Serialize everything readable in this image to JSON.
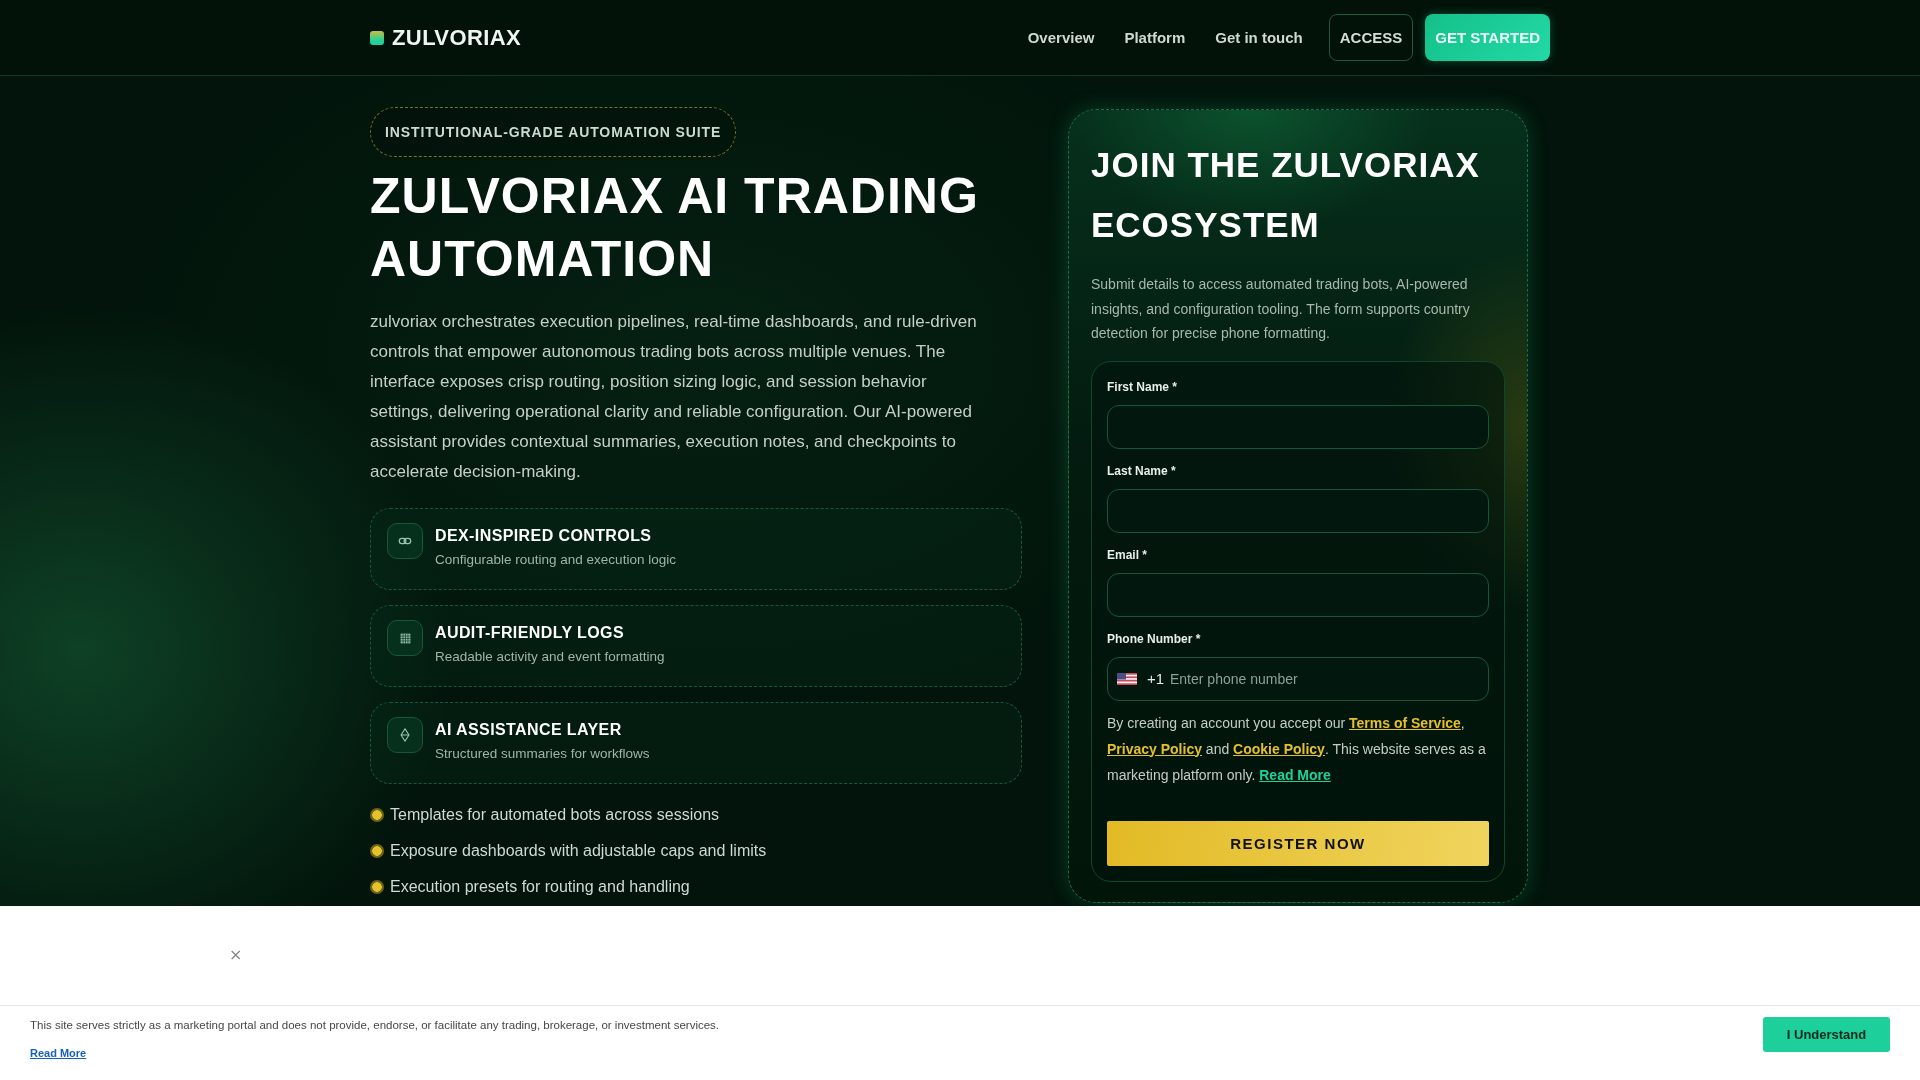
{
  "header": {
    "brand": "ZULVORIAX",
    "nav": [
      "Overview",
      "Platform",
      "Get in touch"
    ],
    "actions": [
      {
        "label": "ACCESS",
        "kind": "outline"
      },
      {
        "label": "GET STARTED",
        "kind": "primary"
      }
    ]
  },
  "hero": {
    "badge": "INSTITUTIONAL-GRADE AUTOMATION SUITE",
    "title": "ZULVORIAX AI TRADING AUTOMATION",
    "description": "zulvoriax orchestrates execution pipelines, real-time dashboards, and rule-driven controls that empower autonomous trading bots across multiple venues. The interface exposes crisp routing, position sizing logic, and session behavior settings, delivering operational clarity and reliable configuration. Our AI-powered assistant provides contextual summaries, execution notes, and checkpoints to accelerate decision-making.",
    "features": [
      {
        "title": "DEX-INSPIRED CONTROLS",
        "subtitle": "Configurable routing and execution logic"
      },
      {
        "title": "AUDIT-FRIENDLY LOGS",
        "subtitle": "Readable activity and event formatting"
      },
      {
        "title": "AI ASSISTANCE LAYER",
        "subtitle": "Structured summaries for workflows"
      }
    ],
    "bullets": [
      "Templates for automated bots across sessions",
      "Exposure dashboards with adjustable caps and limits",
      "Execution presets for routing and handling"
    ]
  },
  "signup": {
    "title": "JOIN THE ZULVORIAX ECOSYSTEM",
    "description": "Submit details to access automated trading bots, AI-powered insights, and configuration tooling. The form supports country detection for precise phone formatting.",
    "fields": [
      {
        "label": "First Name *",
        "kind": "text"
      },
      {
        "label": "Last Name *",
        "kind": "text"
      },
      {
        "label": "Email *",
        "kind": "email"
      },
      {
        "label": "Phone Number *",
        "kind": "phone",
        "dial_code": "+1",
        "placeholder": "Enter phone number"
      }
    ],
    "consent": [
      {
        "text": "By creating an account you accept our ",
        "kind": "text"
      },
      {
        "text": "Terms of Service",
        "kind": "link"
      },
      {
        "text": ", ",
        "kind": "text"
      },
      {
        "text": "Privacy Policy",
        "kind": "link"
      },
      {
        "text": " and ",
        "kind": "text"
      },
      {
        "text": "Cookie Policy",
        "kind": "link"
      },
      {
        "text": ". This website serves as a marketing platform only. ",
        "kind": "text"
      },
      {
        "text": "Read More",
        "kind": "more"
      }
    ],
    "submit": "REGISTER NOW"
  },
  "overlay": {
    "close": "×"
  },
  "cookie_notice": {
    "text": "This site serves strictly as a marketing portal and does not provide, endorse, or facilitate any trading, brokerage, or investment services.",
    "link": "Read More",
    "button": "I Understand"
  }
}
